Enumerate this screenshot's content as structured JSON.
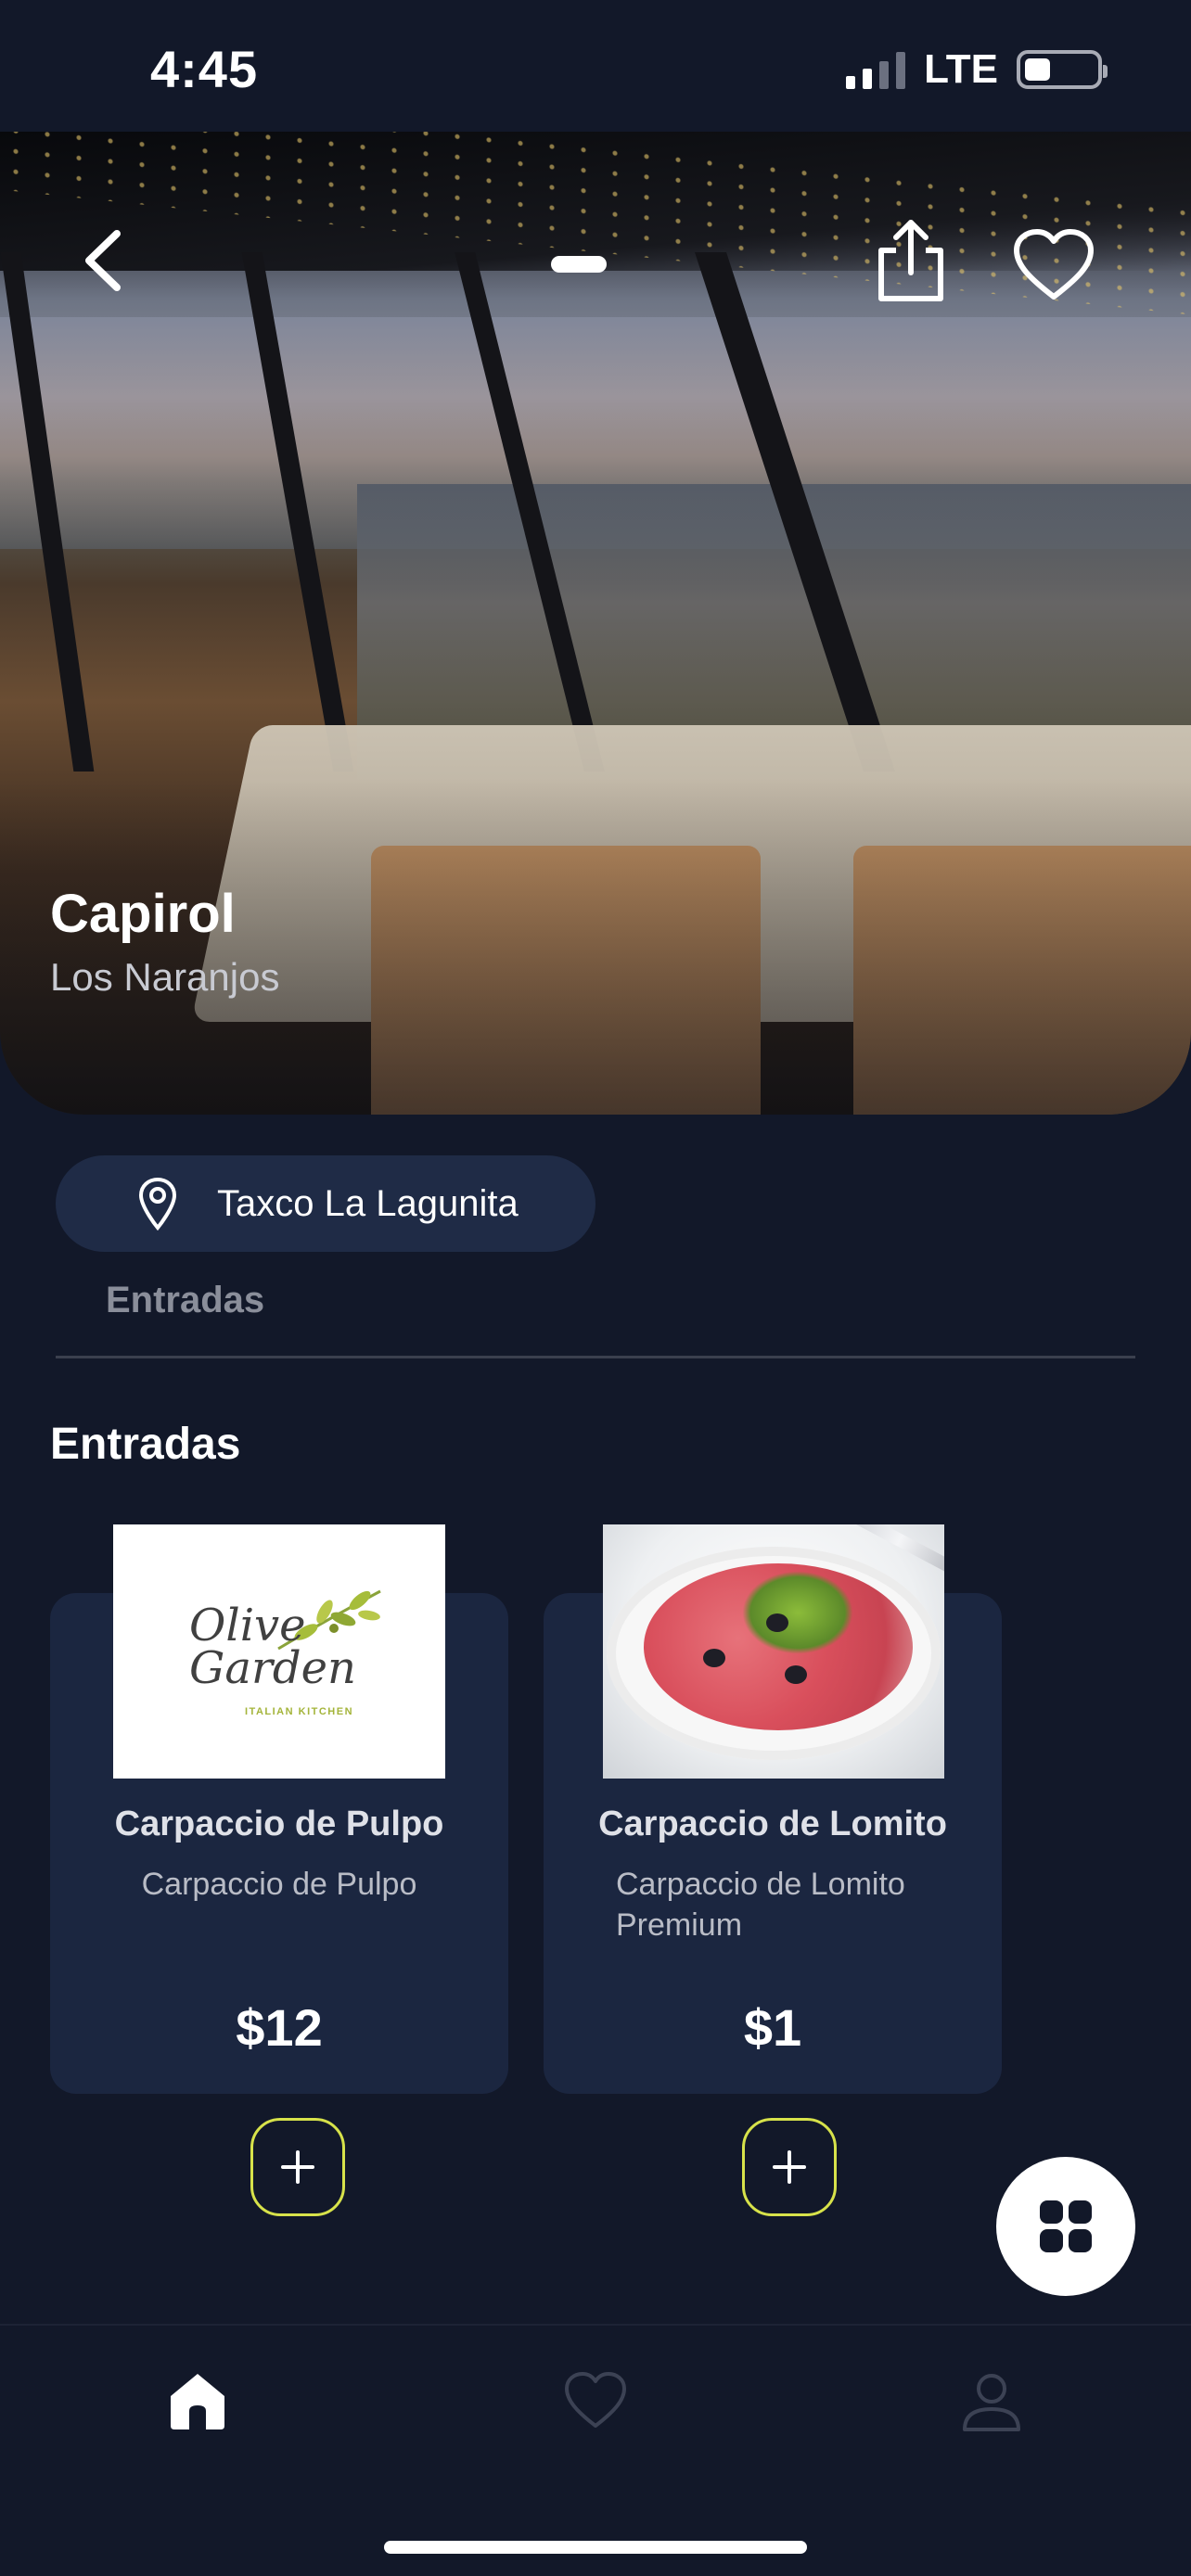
{
  "status_bar": {
    "time": "4:45",
    "network": "LTE",
    "battery_level": 0.36
  },
  "hero": {
    "name": "Capirol",
    "area": "Los Naranjos",
    "icons": [
      "chevron-left-icon",
      "share-icon",
      "heart-icon"
    ]
  },
  "location": {
    "label": "Taxco La Lagunita",
    "icon": "map-pin-icon"
  },
  "categories": {
    "tabs": [
      "Entradas"
    ]
  },
  "section": {
    "title": "Entradas"
  },
  "products": [
    {
      "title": "Carpaccio de Pulpo",
      "description": "Carpaccio de Pulpo",
      "price": "$12",
      "image": "olive-garden-logo",
      "logo_text": "Olive Garden",
      "logo_subtitle": "ITALIAN KITCHEN"
    },
    {
      "title": "Carpaccio de Lomito",
      "description": "Carpaccio de Lomito Premium",
      "price": "$1",
      "image": "carpaccio-photo"
    }
  ],
  "fab": {
    "icon": "grid-icon"
  },
  "bottom_nav": {
    "items": [
      "home-icon",
      "heart-icon",
      "user-icon"
    ],
    "active": "home-icon"
  },
  "colors": {
    "background": "#121829",
    "card": "#1b2640",
    "pill": "#1f2b46",
    "accent": "#d7e24a"
  }
}
